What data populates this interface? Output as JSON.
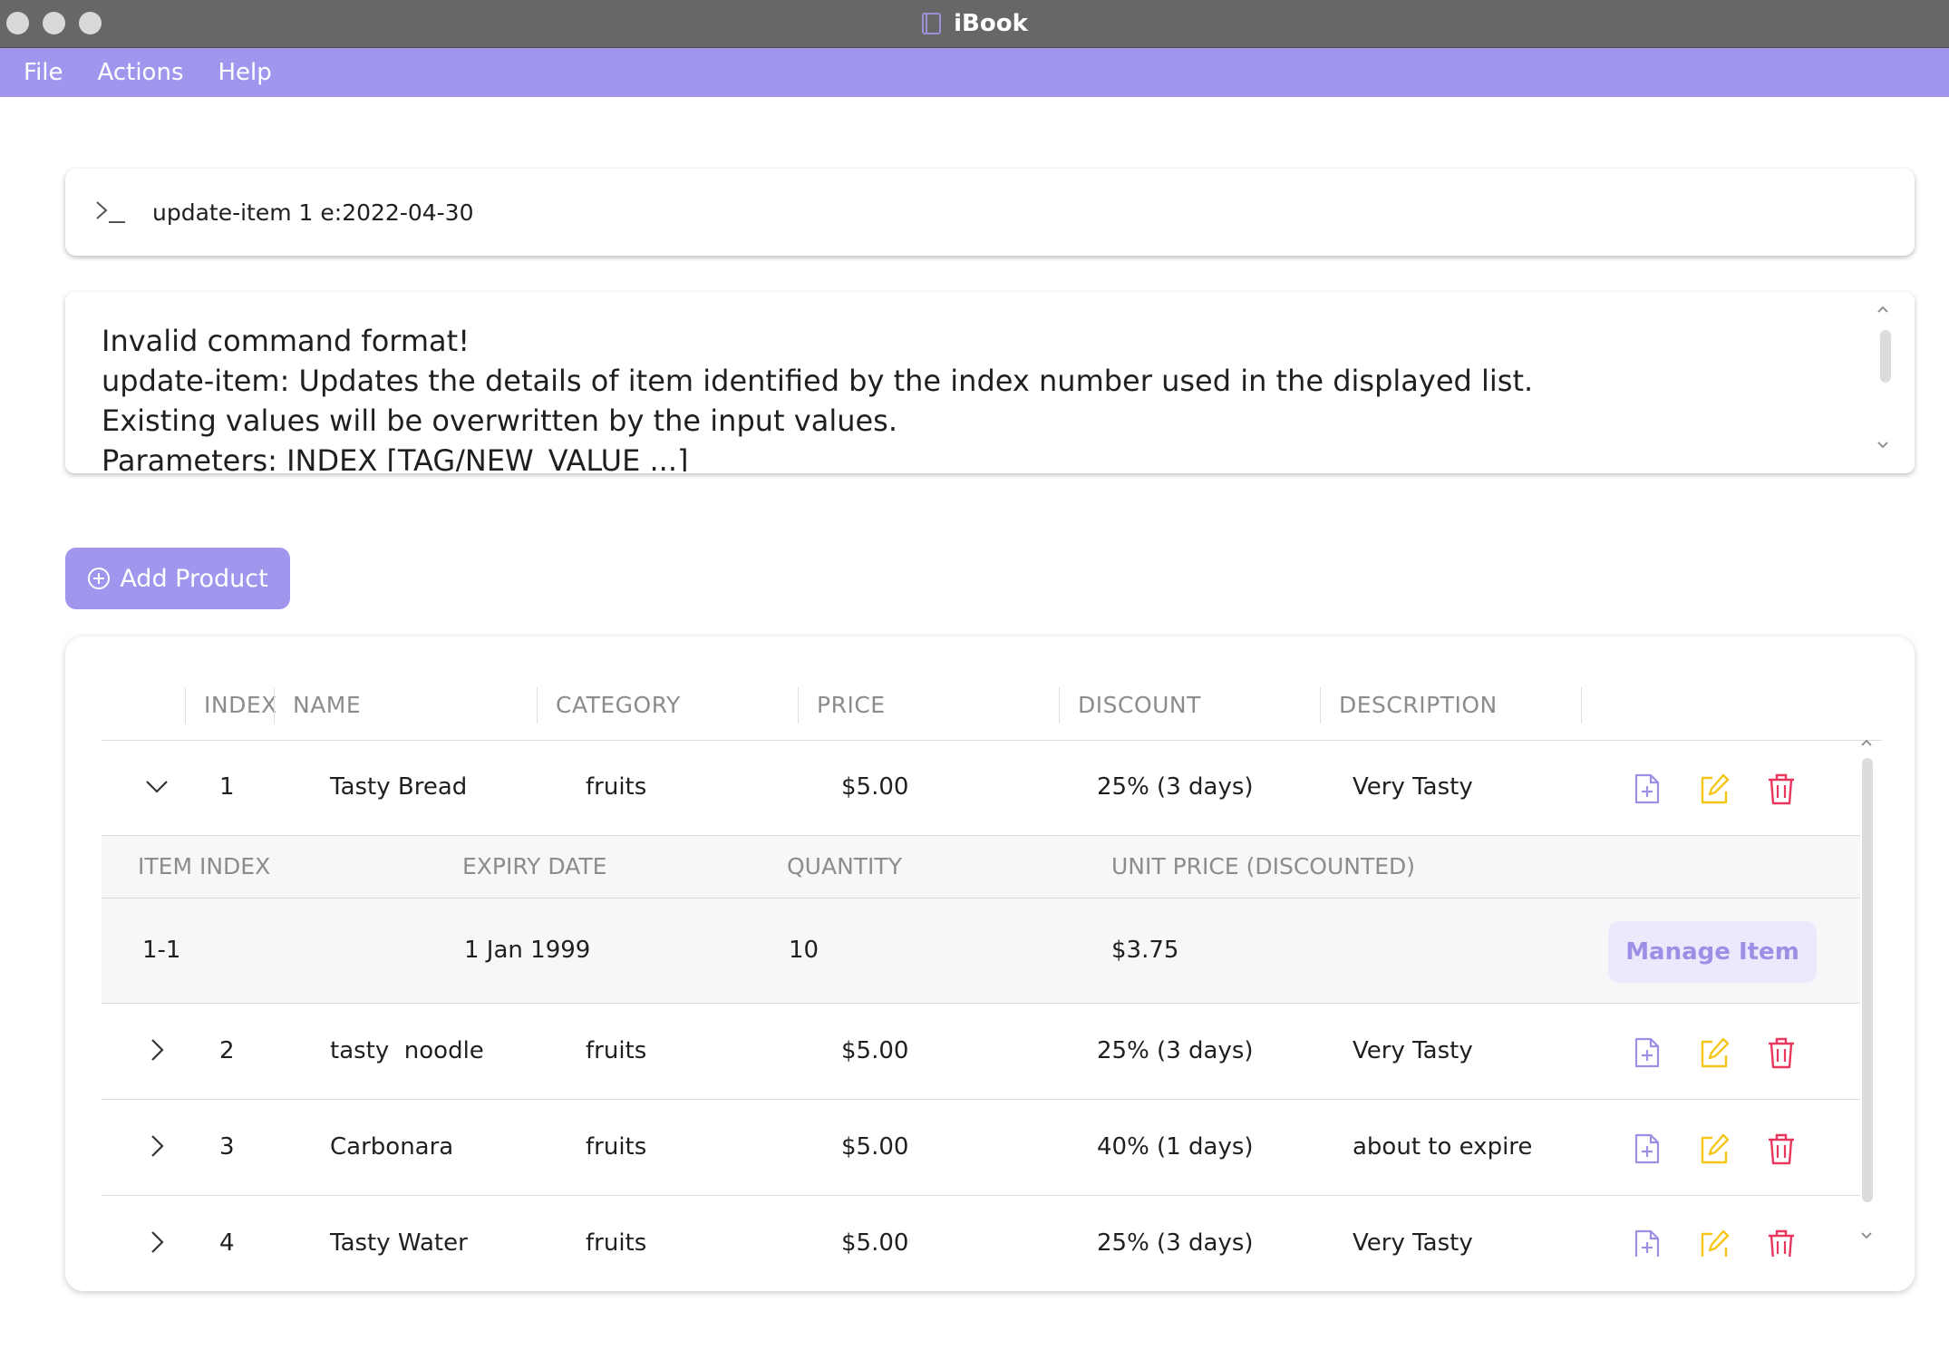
{
  "window": {
    "title": "iBook"
  },
  "menu": [
    "File",
    "Actions",
    "Help"
  ],
  "command": {
    "value": "update-item 1 e:2022-04-30"
  },
  "result": {
    "lines": [
      "Invalid command format!",
      "update-item: Updates the details of item identified by the index number used in the displayed list.",
      "Existing values will be overwritten by the input values.",
      "Parameters: INDEX [TAG/NEW_VALUE ...]"
    ]
  },
  "add_product_label": "Add Product",
  "table": {
    "columns": [
      "INDEX",
      "NAME",
      "CATEGORY",
      "PRICE",
      "DISCOUNT",
      "DESCRIPTION"
    ],
    "rows": [
      {
        "index": "1",
        "name": "Tasty Bread",
        "category": "fruits",
        "price": "$5.00",
        "discount": "25% (3 days)",
        "description": "Very Tasty",
        "expanded": true
      },
      {
        "index": "2",
        "name": "tasty  noodle",
        "category": "fruits",
        "price": "$5.00",
        "discount": "25% (3 days)",
        "description": "Very Tasty",
        "expanded": false
      },
      {
        "index": "3",
        "name": "Carbonara",
        "category": "fruits",
        "price": "$5.00",
        "discount": "40% (1 days)",
        "description": "about to expire",
        "expanded": false
      },
      {
        "index": "4",
        "name": "Tasty Water",
        "category": "fruits",
        "price": "$5.00",
        "discount": "25% (3 days)",
        "description": "Very Tasty",
        "expanded": false
      }
    ],
    "sub_columns": [
      "ITEM INDEX",
      "EXPIRY DATE",
      "QUANTITY",
      "UNIT PRICE (DISCOUNTED)"
    ],
    "sub_rows": [
      {
        "item_index": "1-1",
        "expiry": "1 Jan 1999",
        "quantity": "10",
        "unit_price": "$3.75"
      }
    ],
    "manage_item_label": "Manage Item"
  },
  "colors": {
    "accent": "#a096ee",
    "add_icon": "#9c8fe6",
    "edit_icon": "#f5c518",
    "delete_icon": "#e8365d"
  },
  "icons": {
    "row_add": "file-plus-icon",
    "row_edit": "edit-icon",
    "row_delete": "trash-icon",
    "expand": "chevron-icon"
  }
}
